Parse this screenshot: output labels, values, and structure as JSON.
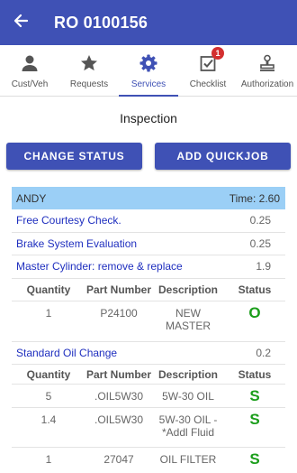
{
  "header": {
    "title": "RO 0100156",
    "back_icon": "arrow-back-icon"
  },
  "tabs": [
    {
      "label": "Cust/Veh",
      "icon": "person-icon",
      "active": false
    },
    {
      "label": "Requests",
      "icon": "star-icon",
      "active": false
    },
    {
      "label": "Services",
      "icon": "gear-icon",
      "active": true
    },
    {
      "label": "Checklist",
      "icon": "checklist-icon",
      "active": false,
      "badge": "1"
    },
    {
      "label": "Authorization",
      "icon": "stamp-icon",
      "active": false
    }
  ],
  "section_title": "Inspection",
  "buttons": {
    "change_status": "CHANGE STATUS",
    "add_quickjob": "ADD QUICKJOB"
  },
  "tech": {
    "name": "ANDY",
    "time": "Time: 2.60"
  },
  "jobs": [
    {
      "name": "Free Courtesy Check.",
      "hours": "0.25"
    },
    {
      "name": "Brake System Evaluation",
      "hours": "0.25"
    },
    {
      "name": "Master Cylinder: remove & replace",
      "hours": "1.9"
    },
    {
      "name": "Standard Oil Change",
      "hours": "0.2"
    }
  ],
  "parts_headers": {
    "quantity": "Quantity",
    "part_number": "Part Number",
    "description": "Description",
    "status": "Status"
  },
  "parts_master": [
    {
      "quantity": "1",
      "part_number": "P24100",
      "description": "NEW MASTER",
      "status": "O"
    }
  ],
  "parts_oil": [
    {
      "quantity": "5",
      "part_number": ".OIL5W30",
      "description": "5W-30 OIL",
      "status": "S"
    },
    {
      "quantity": "1.4",
      "part_number": ".OIL5W30",
      "description": "5W-30 OIL - *Addl Fluid",
      "status": "S"
    },
    {
      "quantity": "1",
      "part_number": "27047",
      "description": "OIL FILTER",
      "status": "S"
    }
  ],
  "colors": {
    "primary": "#3f51b5",
    "tech_bar": "#9bcff6",
    "link": "#1f2fbf",
    "status_green": "#1b9e1b",
    "badge": "#d32f2f"
  }
}
